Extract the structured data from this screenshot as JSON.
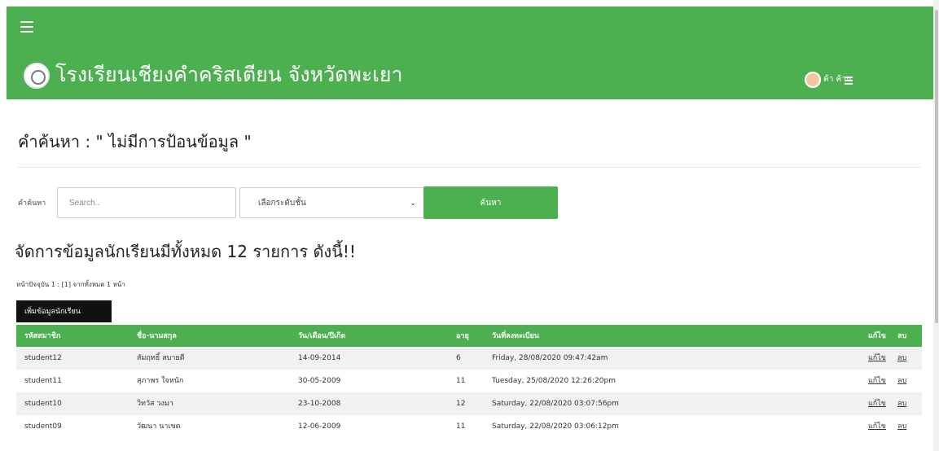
{
  "header": {
    "site_title": "โรงเรียนเชียงคำคริสเตียน จังหวัดพะเยา",
    "user_name": "ค้า ค้าน"
  },
  "search": {
    "heading": "คำค้นหา : \" ไม่มีการป้อนข้อมูล \"",
    "label": "คำค้นหา",
    "placeholder": "Search..",
    "level_placeholder": "เลือกระดับชั้น",
    "button_label": "ค้นหา"
  },
  "manage": {
    "heading": "จัดการข้อมูลนักเรียนมีทั้งหมด 12 รายการ ดังนี้!!",
    "page_info": "หน้าปัจจุบัน 1 : [1] จากทั้งหมด 1 หน้า",
    "add_button": "เพิ่มข้อมูลนักเรียน"
  },
  "table": {
    "headers": {
      "id": "รหัสสมาชิก",
      "name": "ชื่อ-นามสกุล",
      "dob": "วัน/เดือน/ปีเกิด",
      "age": "อายุ",
      "reg": "วันที่ลงทะเบียน",
      "edit": "แก้ไข",
      "del": "ลบ"
    },
    "rows": [
      {
        "id": "student12",
        "name": "สัมฤทธิ์ สบายดี",
        "dob": "14-09-2014",
        "age": "6",
        "reg": "Friday, 28/08/2020 09:47:42am",
        "edit": "แก้ไข",
        "del": "ลบ"
      },
      {
        "id": "student11",
        "name": "สุภาพร ใจหนัก",
        "dob": "30-05-2009",
        "age": "11",
        "reg": "Tuesday, 25/08/2020 12:26:20pm",
        "edit": "แก้ไข",
        "del": "ลบ"
      },
      {
        "id": "student10",
        "name": "วิทวัส วงมา",
        "dob": "23-10-2008",
        "age": "12",
        "reg": "Saturday, 22/08/2020 03:07:56pm",
        "edit": "แก้ไข",
        "del": "ลบ"
      },
      {
        "id": "student09",
        "name": "วัฒนา นาเขต",
        "dob": "12-06-2009",
        "age": "11",
        "reg": "Saturday, 22/08/2020 03:06:12pm",
        "edit": "แก้ไข",
        "del": "ลบ"
      }
    ]
  },
  "colors": {
    "brand_green": "#4caf50",
    "button_black": "#111111",
    "stripe": "#f1f1f1"
  }
}
